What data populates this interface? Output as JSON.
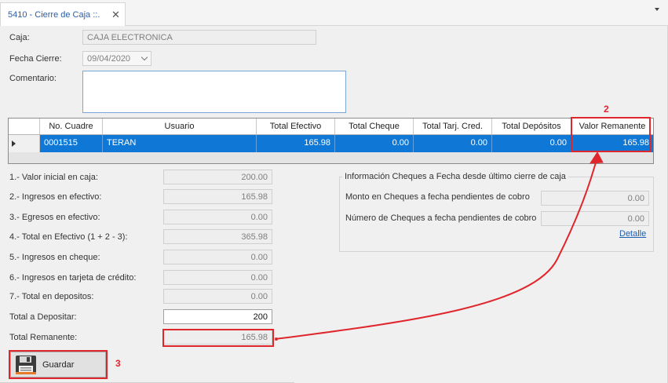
{
  "tab": {
    "title": "5410 - Cierre de Caja ::.",
    "close_glyph": "✕"
  },
  "form": {
    "caja_label": "Caja:",
    "caja_value": "CAJA ELECTRONICA",
    "fecha_label": "Fecha Cierre:",
    "fecha_value": "09/04/2020",
    "comentario_label": "Comentario:",
    "comentario_value": ""
  },
  "grid": {
    "columns": [
      "No. Cuadre",
      "Usuario",
      "Total Efectivo",
      "Total Cheque",
      "Total Tarj. Cred.",
      "Total Depósitos",
      "Valor Remanente"
    ],
    "rows": [
      {
        "no_cuadre": "0001515",
        "usuario": "TERAN",
        "total_efectivo": "165.98",
        "total_cheque": "0.00",
        "total_tarj": "0.00",
        "total_depositos": "0.00",
        "valor_remanente": "165.98"
      }
    ]
  },
  "summary": [
    {
      "label": "1.- Valor inicial en caja:",
      "value": "200.00"
    },
    {
      "label": "2.- Ingresos en efectivo:",
      "value": "165.98"
    },
    {
      "label": "3.- Egresos en efectivo:",
      "value": "0.00"
    },
    {
      "label": "4.- Total en Efectivo (1 + 2 - 3):",
      "value": "365.98"
    },
    {
      "label": "5.- Ingresos en cheque:",
      "value": "0.00"
    },
    {
      "label": "6.- Ingresos en tarjeta de crédito:",
      "value": "0.00"
    },
    {
      "label": "7.- Total en depositos:",
      "value": "0.00"
    }
  ],
  "total_depositar": {
    "label": "Total a Depositar:",
    "value": "200"
  },
  "total_remanente": {
    "label": "Total Remanente:",
    "value": "165.98"
  },
  "cheques": {
    "title": "Información Cheques a Fecha desde último cierre de caja",
    "monto_label": "Monto en Cheques a fecha pendientes de cobro",
    "monto_value": "0.00",
    "numero_label": "Número de Cheques a fecha pendientes de cobro",
    "numero_value": "0.00",
    "detalle_link": "Detalle"
  },
  "actions": {
    "save_label": "Guardar"
  },
  "annotations": {
    "marker_2": "2",
    "marker_3": "3",
    "color": "#e0262d"
  },
  "icons": {
    "floppy": "floppy-disk-icon",
    "dropdown": "chevron-down-icon",
    "tab_menu": "caret-down-icon",
    "row_pointer": "row-indicator-icon"
  }
}
